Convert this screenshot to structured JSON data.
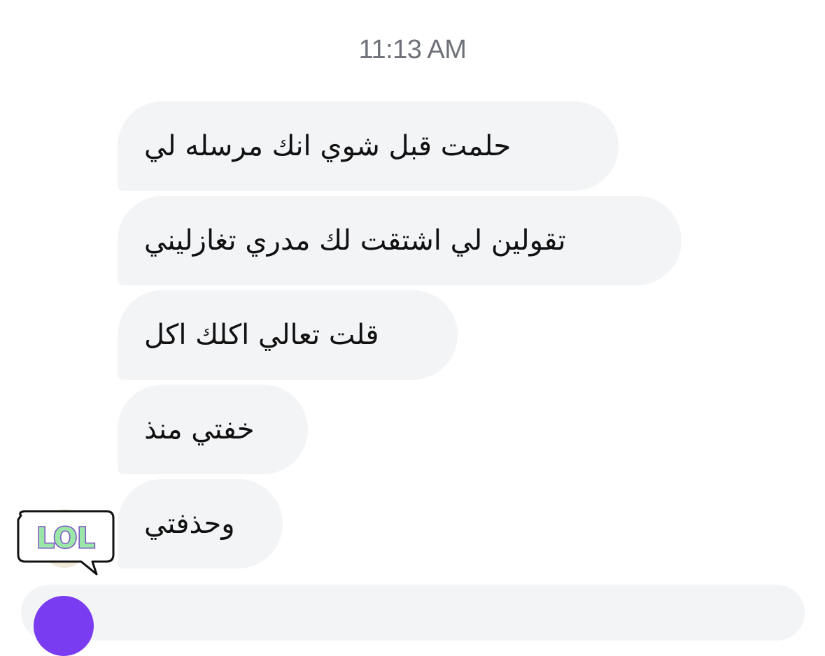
{
  "chat": {
    "timestamp": "11:13 AM",
    "messages": [
      {
        "text": "حلمت قبل شوي انك مرسله لي"
      },
      {
        "text": "تقولين لي اشتقت لك مدري تغازليني"
      },
      {
        "text": "قلت تعالي اكلك اكل"
      },
      {
        "text": "خفتي منذ"
      },
      {
        "text": "وحذفتي"
      }
    ],
    "sticker": {
      "text": "LOL",
      "icon": "lol-sticker-icon"
    }
  },
  "colors": {
    "bubble_bg": "#f3f4f6",
    "timestamp": "#6e7178",
    "accent": "#7a3cf0",
    "sticker_fill": "#9be7a8",
    "sticker_outline": "#7b4fc4"
  }
}
